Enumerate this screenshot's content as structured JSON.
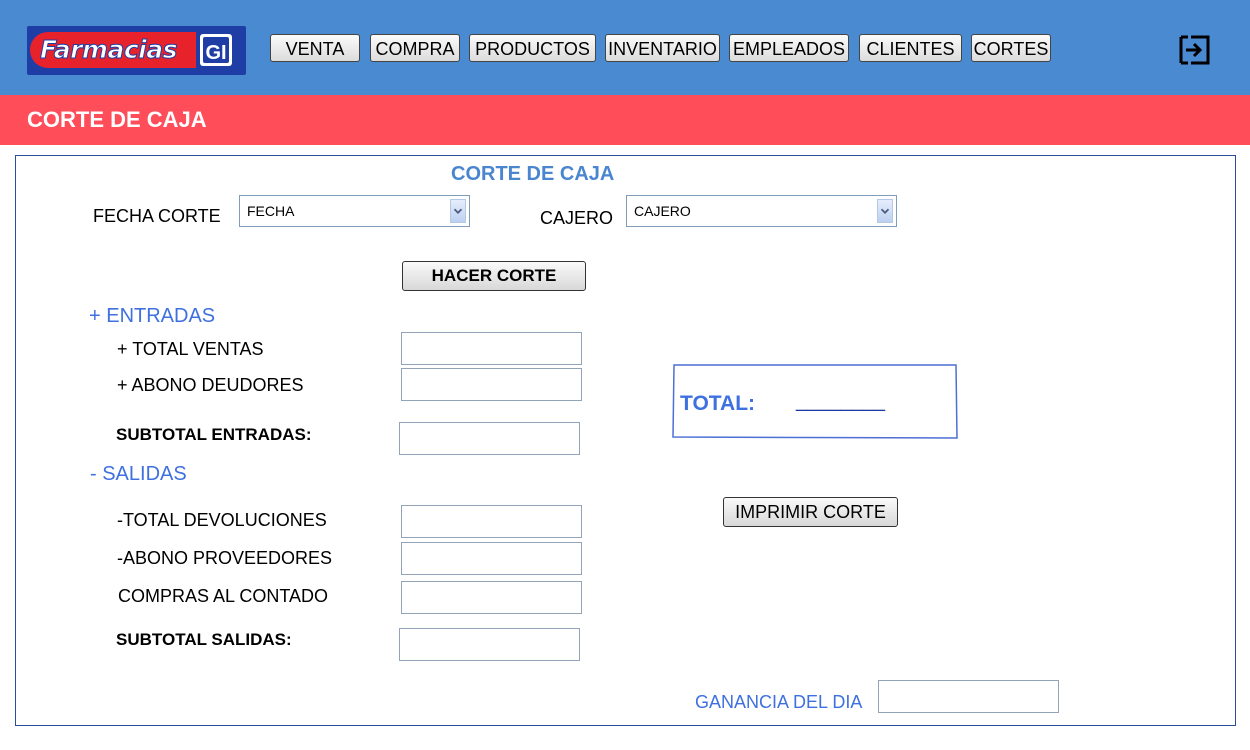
{
  "header": {
    "logo_text": "Farmacias",
    "logo_mark": "GI",
    "nav": [
      {
        "label": "VENTA"
      },
      {
        "label": "COMPRA"
      },
      {
        "label": "PRODUCTOS"
      },
      {
        "label": "INVENTARIO"
      },
      {
        "label": "EMPLEADOS"
      },
      {
        "label": "CLIENTES"
      },
      {
        "label": "CORTES"
      }
    ],
    "logout_icon": "logout-icon"
  },
  "page": {
    "title": "CORTE DE CAJA"
  },
  "form": {
    "heading": "CORTE DE CAJA",
    "fecha_label": "FECHA CORTE",
    "fecha_value": "FECHA",
    "cajero_label": "CAJERO",
    "cajero_value": "CAJERO",
    "hacer_corte": "HACER CORTE",
    "entradas": {
      "heading": "+ ENTRADAS",
      "total_ventas": "+ TOTAL VENTAS",
      "abono_deudores": "+ ABONO DEUDORES",
      "subtotal": "SUBTOTAL ENTRADAS:"
    },
    "salidas": {
      "heading": "- SALIDAS",
      "total_devoluciones": "-TOTAL DEVOLUCIONES",
      "abono_proveedores": "-ABONO PROVEEDORES",
      "compras_contado": "COMPRAS AL CONTADO",
      "subtotal": "SUBTOTAL SALIDAS:"
    },
    "total_label": "TOTAL:",
    "total_value": "________",
    "imprimir": "IMPRIMIR CORTE",
    "ganancia_label": "GANANCIA DEL DIA"
  },
  "colors": {
    "header": "#4a8ad1",
    "title_bar": "#ff4d5a",
    "accent_text": "#3f70e0"
  }
}
